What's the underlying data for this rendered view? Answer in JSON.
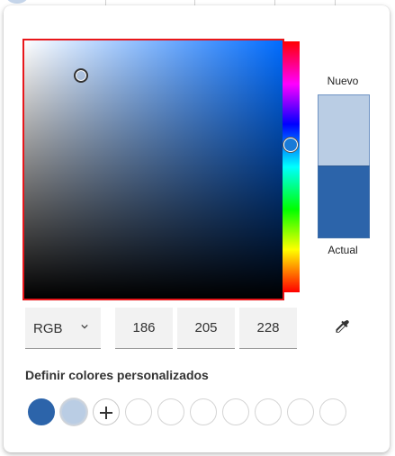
{
  "picker": {
    "new_label": "Nuevo",
    "current_label": "Actual",
    "new_color": "#bacde4",
    "current_color": "#2c64aa",
    "hue_color": "#006cff",
    "mode": "RGB",
    "r": "186",
    "g": "205",
    "b": "228"
  },
  "custom": {
    "title": "Definir colores personalizados",
    "colors": [
      "#2c64aa",
      "#bacde4"
    ]
  },
  "icons": {
    "dropdown": "chevron-down-icon",
    "eyedropper": "eyedropper-icon",
    "add": "plus-icon"
  }
}
